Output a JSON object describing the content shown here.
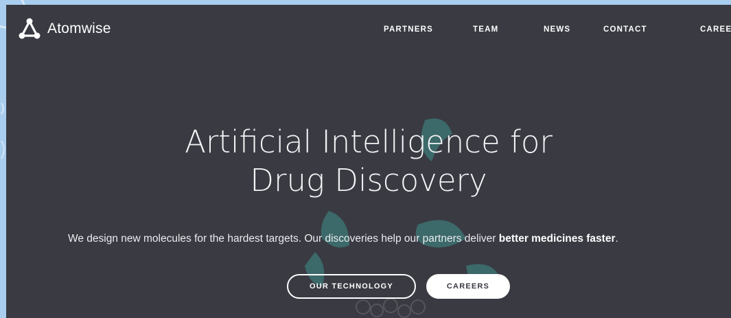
{
  "brand": {
    "name": "Atomwise"
  },
  "nav": {
    "items": [
      {
        "label": "PARTNERS"
      },
      {
        "label": "TEAM"
      },
      {
        "label": "NEWS"
      },
      {
        "label": "CONTACT"
      },
      {
        "label": "CAREE"
      }
    ]
  },
  "hero": {
    "headline_line1": "Artificial Intelligence for",
    "headline_line2": "Drug Discovery",
    "tagline_prefix": "We design new molecules for the hardest targets. Our discoveries help our partners deliver ",
    "tagline_emphasis": "better medicines faster",
    "tagline_suffix": ".",
    "primary_button": "OUR TECHNOLOGY",
    "secondary_button": "CAREERS"
  },
  "colors": {
    "page_background": "#a9cdee",
    "hero_background": "#393a42",
    "accent_teal": "#3f8f8a",
    "text": "#ffffff"
  },
  "icons": {
    "logo": "atom-triangle-logo-icon"
  }
}
